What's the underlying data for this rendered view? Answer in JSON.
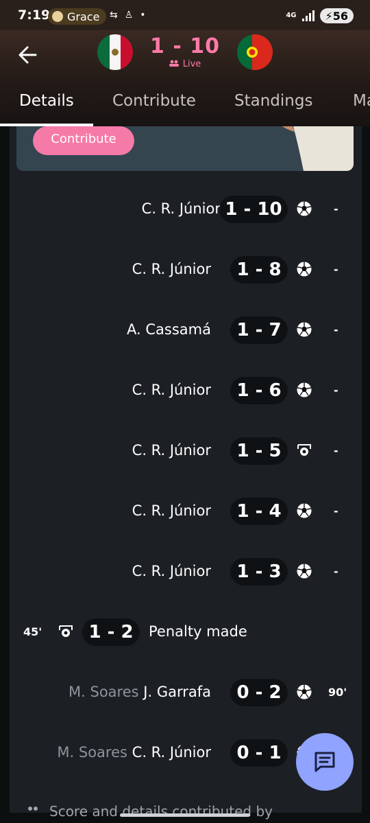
{
  "status_bar": {
    "time": "7:19",
    "spotify_label": "Grace",
    "network": "4G",
    "battery": "56"
  },
  "match": {
    "score": "1 - 10",
    "live_label": "Live",
    "home_flag": "mexico-flag",
    "away_flag": "portugal-flag"
  },
  "tabs": [
    "Details",
    "Contribute",
    "Standings",
    "Ma"
  ],
  "banner": {
    "button_label": "Contribute"
  },
  "events": [
    {
      "player": "C. R. Júnior",
      "assist": "",
      "score": "1 - 10",
      "icon": "ball-icon",
      "minute": "-"
    },
    {
      "player": "C. R. Júnior",
      "assist": "",
      "score": "1 - 8",
      "icon": "ball-icon",
      "minute": "-"
    },
    {
      "player": "A. Cassamá",
      "assist": "",
      "score": "1 - 7",
      "icon": "ball-icon",
      "minute": "-"
    },
    {
      "player": "C. R. Júnior",
      "assist": "",
      "score": "1 - 6",
      "icon": "ball-icon",
      "minute": "-"
    },
    {
      "player": "C. R. Júnior",
      "assist": "",
      "score": "1 - 5",
      "icon": "penalty-icon",
      "minute": "-"
    },
    {
      "player": "C. R. Júnior",
      "assist": "",
      "score": "1 - 4",
      "icon": "ball-icon",
      "minute": "-"
    },
    {
      "player": "C. R. Júnior",
      "assist": "",
      "score": "1 - 3",
      "icon": "ball-icon",
      "minute": "-"
    },
    {
      "side": "home",
      "minute": "45'",
      "icon": "penalty-icon",
      "score": "1 - 2",
      "text": "Penalty made"
    },
    {
      "player": "J. Garrafa",
      "assist": "M. Soares",
      "score": "0 - 2",
      "icon": "ball-icon",
      "minute": "90'"
    },
    {
      "player": "C. R. Júnior",
      "assist": "M. Soares",
      "score": "0 - 1",
      "icon": "ball-icon",
      "minute": ""
    }
  ],
  "footer_text": "Score and details contributed by",
  "colors": {
    "accent_pink": "#ff7aa8",
    "fab": "#8fa3ff",
    "panel": "#1c2024"
  }
}
